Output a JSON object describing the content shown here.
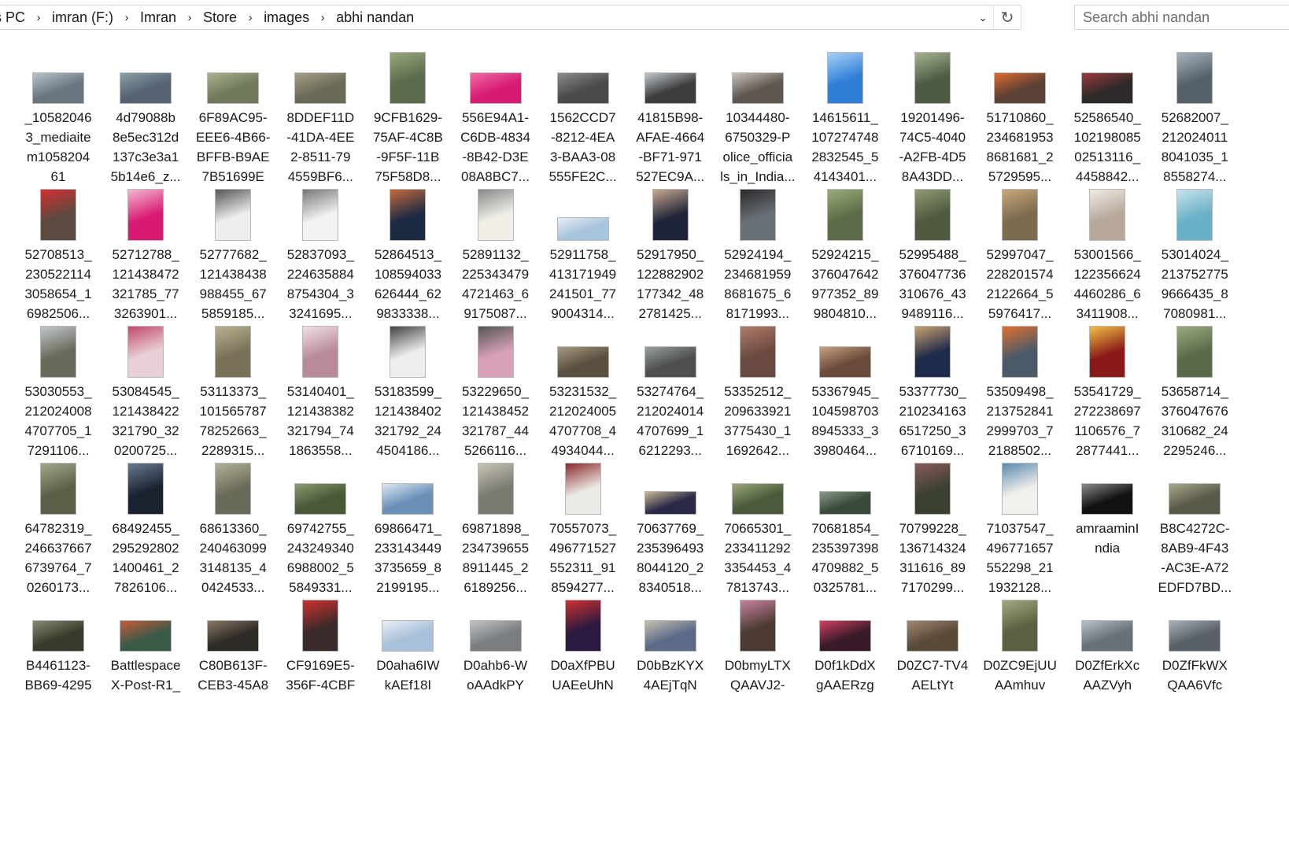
{
  "address_bar": {
    "breadcrumbs": [
      "s PC",
      "imran (F:)",
      "Imran",
      "Store",
      "images",
      "abhi nandan"
    ],
    "separator_icon": "chevron-right-icon",
    "dropdown_icon": "chevron-down-icon",
    "dropdown_glyph": "⌄",
    "refresh_icon": "refresh-icon",
    "refresh_glyph": "↻",
    "separator_glyph": "›"
  },
  "search": {
    "placeholder": "Search abhi nandan",
    "value": ""
  },
  "files": [
    {
      "name": "_10582046\n3_mediaite\nm1058204\n61",
      "thumb": {
        "shape": "wide",
        "color": "#6b7580",
        "accent": "#b9c4cc"
      }
    },
    {
      "name": "4d79088b\n8e5ec312d\n137c3e3a1\n5b14e6_z...",
      "thumb": {
        "shape": "wide",
        "color": "#556270",
        "accent": "#8aa0a8"
      }
    },
    {
      "name": "6F89AC95-\nEEE6-4B66-\nBFFB-B9AE\n7B51699E",
      "thumb": {
        "shape": "wide",
        "color": "#707a5a",
        "accent": "#a9b08c"
      }
    },
    {
      "name": "8DDEF11D\n-41DA-4EE\n2-8511-79\n4559BF6...",
      "thumb": {
        "shape": "wide",
        "color": "#6b6a58",
        "accent": "#a49f86"
      }
    },
    {
      "name": "9CFB1629-\n75AF-4C8B\n-9F5F-11B\n75F58D8...",
      "thumb": {
        "shape": "tall",
        "color": "#5a6a4a",
        "accent": "#9aa87a"
      }
    },
    {
      "name": "556E94A1-\nC6DB-4834\n-8B42-D3E\n08A8BC7...",
      "thumb": {
        "shape": "wide",
        "color": "#d81b72",
        "accent": "#f06aa6"
      }
    },
    {
      "name": "1562CCD7\n-8212-4EA\n3-BAA3-08\n555FE2C...",
      "thumb": {
        "shape": "wide",
        "color": "#4a4a4a",
        "accent": "#8c8c8c"
      }
    },
    {
      "name": "41815B98-\nAFAE-4664\n-BF71-971\n527EC9A...",
      "thumb": {
        "shape": "wide",
        "color": "#3d3d3d",
        "accent": "#bfc7cc"
      }
    },
    {
      "name": "10344480-\n6750329-P\nolice_officia\nls_in_India...",
      "thumb": {
        "shape": "wide",
        "color": "#5e5650",
        "accent": "#c7bfb8"
      }
    },
    {
      "name": "14615611_\n107274748\n2832545_5\n4143401...",
      "thumb": {
        "shape": "tall",
        "color": "#2f7fd8",
        "accent": "#a9d0f5"
      }
    },
    {
      "name": "19201496-\n74C5-4040\n-A2FB-4D5\n8A43DD...",
      "thumb": {
        "shape": "tall",
        "color": "#4e5a44",
        "accent": "#a5b38f"
      }
    },
    {
      "name": "51710860_\n234681953\n8681681_2\n5729595...",
      "thumb": {
        "shape": "wide",
        "color": "#5a4035",
        "accent": "#e06a2c"
      }
    },
    {
      "name": "52586540_\n102198085\n02513116_\n4458842...",
      "thumb": {
        "shape": "wide",
        "color": "#2e2a2a",
        "accent": "#9c3a3a"
      }
    },
    {
      "name": "52682007_\n212024011\n8041035_1\n8558274...",
      "thumb": {
        "shape": "tall",
        "color": "#55606a",
        "accent": "#a7b4be"
      }
    },
    {
      "name": "52708513_\n230522114\n3058654_1\n6982506...",
      "thumb": {
        "shape": "tall",
        "color": "#5a4a40",
        "accent": "#d32f2f"
      }
    },
    {
      "name": "52712788_\n121438472\n321785_77\n3263901...",
      "thumb": {
        "shape": "tall",
        "color": "#d81b72",
        "accent": "#f4b7d0"
      }
    },
    {
      "name": "52777682_\n121438438\n988455_67\n5859185...",
      "thumb": {
        "shape": "tall",
        "color": "#eeeeee",
        "accent": "#555555"
      }
    },
    {
      "name": "52837093_\n224635884\n8754304_3\n3241695...",
      "thumb": {
        "shape": "tall",
        "color": "#f2f2f2",
        "accent": "#777777"
      }
    },
    {
      "name": "52864513_\n108594033\n626444_62\n9833338...",
      "thumb": {
        "shape": "tall",
        "color": "#1d2a44",
        "accent": "#c46a3a"
      }
    },
    {
      "name": "52891132_\n225343479\n4721463_6\n9175087...",
      "thumb": {
        "shape": "tall",
        "color": "#f1efe8",
        "accent": "#888888"
      }
    },
    {
      "name": "52911758_\n413171949\n241501_77\n9004314...",
      "thumb": {
        "shape": "flat",
        "color": "#a8c4dc",
        "accent": "#e6eef5"
      }
    },
    {
      "name": "52917950_\n122882902\n177342_48\n2781425...",
      "thumb": {
        "shape": "tall",
        "color": "#1f2438",
        "accent": "#c8a890"
      }
    },
    {
      "name": "52924194_\n234681959\n8681675_6\n8171993...",
      "thumb": {
        "shape": "tall",
        "color": "#6a7078",
        "accent": "#2a2a2a"
      }
    },
    {
      "name": "52924215_\n376047642\n977352_89\n9804810...",
      "thumb": {
        "shape": "tall",
        "color": "#5c6a48",
        "accent": "#9aab78"
      }
    },
    {
      "name": "52995488_\n376047736\n310676_43\n9489116...",
      "thumb": {
        "shape": "tall",
        "color": "#4f5a40",
        "accent": "#8e9a70"
      }
    },
    {
      "name": "52997047_\n228201574\n2122664_5\n5976417...",
      "thumb": {
        "shape": "tall",
        "color": "#7a6a50",
        "accent": "#c9a878"
      }
    },
    {
      "name": "53001566_\n122356624\n4460286_6\n3411908...",
      "thumb": {
        "shape": "tall",
        "color": "#b7a89a",
        "accent": "#f0ebe6"
      }
    },
    {
      "name": "53014024_\n213752775\n9666435_8\n7080981...",
      "thumb": {
        "shape": "tall",
        "color": "#6ab0c8",
        "accent": "#c8e2ea"
      }
    },
    {
      "name": "53030553_\n212024008\n4707705_1\n7291106...",
      "thumb": {
        "shape": "tall",
        "color": "#6a6a5a",
        "accent": "#c0c6cc"
      }
    },
    {
      "name": "53084545_\n121438422\n321790_32\n0200725...",
      "thumb": {
        "shape": "tall",
        "color": "#e8d0d6",
        "accent": "#c24a6a"
      }
    },
    {
      "name": "53113373_\n101565787\n78252663_\n2289315...",
      "thumb": {
        "shape": "tall",
        "color": "#7a7258",
        "accent": "#b8b090"
      }
    },
    {
      "name": "53140401_\n121438382\n321794_74\n1863558...",
      "thumb": {
        "shape": "tall",
        "color": "#b88a9a",
        "accent": "#f0e0e4"
      }
    },
    {
      "name": "53183599_\n121438402\n321792_24\n4504186...",
      "thumb": {
        "shape": "tall",
        "color": "#eeeeee",
        "accent": "#444444"
      }
    },
    {
      "name": "53229650_\n121438452\n321787_44\n5266116...",
      "thumb": {
        "shape": "tall",
        "color": "#d8a0b8",
        "accent": "#555555"
      }
    },
    {
      "name": "53231532_\n212024005\n4707708_4\n4934044...",
      "thumb": {
        "shape": "wide",
        "color": "#5a5040",
        "accent": "#a89a80"
      }
    },
    {
      "name": "53274764_\n212024014\n4707699_1\n6212293...",
      "thumb": {
        "shape": "wide",
        "color": "#4e5050",
        "accent": "#9a9e9e"
      }
    },
    {
      "name": "53352512_\n209633921\n3775430_1\n1692642...",
      "thumb": {
        "shape": "tall",
        "color": "#6a4a40",
        "accent": "#b07a68"
      }
    },
    {
      "name": "53367945_\n104598703\n8945333_3\n3980464...",
      "thumb": {
        "shape": "wide",
        "color": "#6a4a3a",
        "accent": "#c8a080"
      }
    },
    {
      "name": "53377730_\n210234163\n6517250_3\n6710169...",
      "thumb": {
        "shape": "tall",
        "color": "#1e2a4a",
        "accent": "#c9a070"
      }
    },
    {
      "name": "53509498_\n213752841\n2999703_7\n2188502...",
      "thumb": {
        "shape": "tall",
        "color": "#4a5a68",
        "accent": "#e07030"
      }
    },
    {
      "name": "53541729_\n272238697\n1106576_7\n2877441...",
      "thumb": {
        "shape": "tall",
        "color": "#8a1a1a",
        "accent": "#f0c040"
      }
    },
    {
      "name": "53658714_\n376047676\n310682_24\n2295246...",
      "thumb": {
        "shape": "tall",
        "color": "#5a6a48",
        "accent": "#9aaa80"
      }
    },
    {
      "name": "64782319_\n246637667\n6739764_7\n0260173...",
      "thumb": {
        "shape": "tall",
        "color": "#5a6048",
        "accent": "#a0a888"
      }
    },
    {
      "name": "68492455_\n295292802\n1400461_2\n7826106...",
      "thumb": {
        "shape": "tall",
        "color": "#1a2230",
        "accent": "#6a7a90"
      }
    },
    {
      "name": "68613360_\n240463099\n3148135_4\n0424533...",
      "thumb": {
        "shape": "tall",
        "color": "#6a6a58",
        "accent": "#b0b098"
      }
    },
    {
      "name": "69742755_\n243249340\n6988002_5\n5849331...",
      "thumb": {
        "shape": "wide",
        "color": "#4a5838",
        "accent": "#8c9a70"
      }
    },
    {
      "name": "69866471_\n233143449\n3735659_8\n2199195...",
      "thumb": {
        "shape": "wide",
        "color": "#6a90b8",
        "accent": "#dde8f2"
      }
    },
    {
      "name": "69871898_\n234739655\n8911445_2\n6189256...",
      "thumb": {
        "shape": "tall",
        "color": "#7a7a70",
        "accent": "#c8c4b8"
      }
    },
    {
      "name": "70557073_\n496771527\n552311_91\n8594277...",
      "thumb": {
        "shape": "tall",
        "color": "#eceae6",
        "accent": "#8a2a2a"
      }
    },
    {
      "name": "70637769_\n235396493\n8044120_2\n8340518...",
      "thumb": {
        "shape": "flat",
        "color": "#2a2a48",
        "accent": "#c8b890"
      }
    },
    {
      "name": "70665301_\n233411292\n3354453_4\n7813743...",
      "thumb": {
        "shape": "wide",
        "color": "#4a5a3a",
        "accent": "#9aa878"
      }
    },
    {
      "name": "70681854_\n235397398\n4709882_5\n0325781...",
      "thumb": {
        "shape": "flat",
        "color": "#3a4a3a",
        "accent": "#8a9a88"
      }
    },
    {
      "name": "70799228_\n136714324\n311616_89\n7170299...",
      "thumb": {
        "shape": "tall",
        "color": "#3a4030",
        "accent": "#8a5a5a"
      }
    },
    {
      "name": "71037547_\n496771657\n552298_21\n1932128...",
      "thumb": {
        "shape": "tall",
        "color": "#f2f0ec",
        "accent": "#5a8ab0"
      }
    },
    {
      "name": "amraaminI\nndia",
      "thumb": {
        "shape": "wide",
        "color": "#111111",
        "accent": "#8a8a8a"
      }
    },
    {
      "name": "B8C4272C-\n8AB9-4F43\n-AC3E-A72\nEDFD7BD...",
      "thumb": {
        "shape": "wide",
        "color": "#5a5a48",
        "accent": "#a8a890"
      }
    },
    {
      "name": "B4461123-\nBB69-4295",
      "thumb": {
        "shape": "wide",
        "color": "#3a3a2a",
        "accent": "#8a8a78"
      }
    },
    {
      "name": "Battlespace\nX-Post-R1_",
      "thumb": {
        "shape": "wide",
        "color": "#3a5a48",
        "accent": "#c85a3a"
      }
    },
    {
      "name": "C80B613F-\nCEB3-45A8",
      "thumb": {
        "shape": "wide",
        "color": "#2e2a26",
        "accent": "#8a7a68"
      }
    },
    {
      "name": "CF9169E5-\n356F-4CBF",
      "thumb": {
        "shape": "tall",
        "color": "#3a2a2a",
        "accent": "#d03030"
      }
    },
    {
      "name": "D0aha6IW\nkAEf18I",
      "thumb": {
        "shape": "wide",
        "color": "#a8c0d8",
        "accent": "#e8eef4"
      }
    },
    {
      "name": "D0ahb6-W\noAAdkPY",
      "thumb": {
        "shape": "wide",
        "color": "#7a7e80",
        "accent": "#c0c4c6"
      }
    },
    {
      "name": "D0aXfPBU\nUAEeUhN",
      "thumb": {
        "shape": "tall",
        "color": "#2a1a40",
        "accent": "#d03030"
      }
    },
    {
      "name": "D0bBzKYX\n4AEjTqN",
      "thumb": {
        "shape": "wide",
        "color": "#5a6a88",
        "accent": "#c8c0b0"
      }
    },
    {
      "name": "D0bmyLTX\nQAAVJ2-",
      "thumb": {
        "shape": "tall",
        "color": "#4a3a30",
        "accent": "#c880a0"
      }
    },
    {
      "name": "D0f1kDdX\ngAAERzg",
      "thumb": {
        "shape": "wide",
        "color": "#3a1a2a",
        "accent": "#d04060"
      }
    },
    {
      "name": "D0ZC7-TV4\nAELtYt",
      "thumb": {
        "shape": "wide",
        "color": "#5a4a3a",
        "accent": "#a08870"
      }
    },
    {
      "name": "D0ZC9EjUU\nAAmhuv",
      "thumb": {
        "shape": "tall",
        "color": "#5a6040",
        "accent": "#a0a880"
      }
    },
    {
      "name": "D0ZfErkXc\nAAZVyh",
      "thumb": {
        "shape": "wide",
        "color": "#6a7078",
        "accent": "#b8c0c8"
      }
    },
    {
      "name": "D0ZfFkWX\nQAA6Vfc",
      "thumb": {
        "shape": "wide",
        "color": "#5a6068",
        "accent": "#a8b0b8"
      }
    }
  ]
}
